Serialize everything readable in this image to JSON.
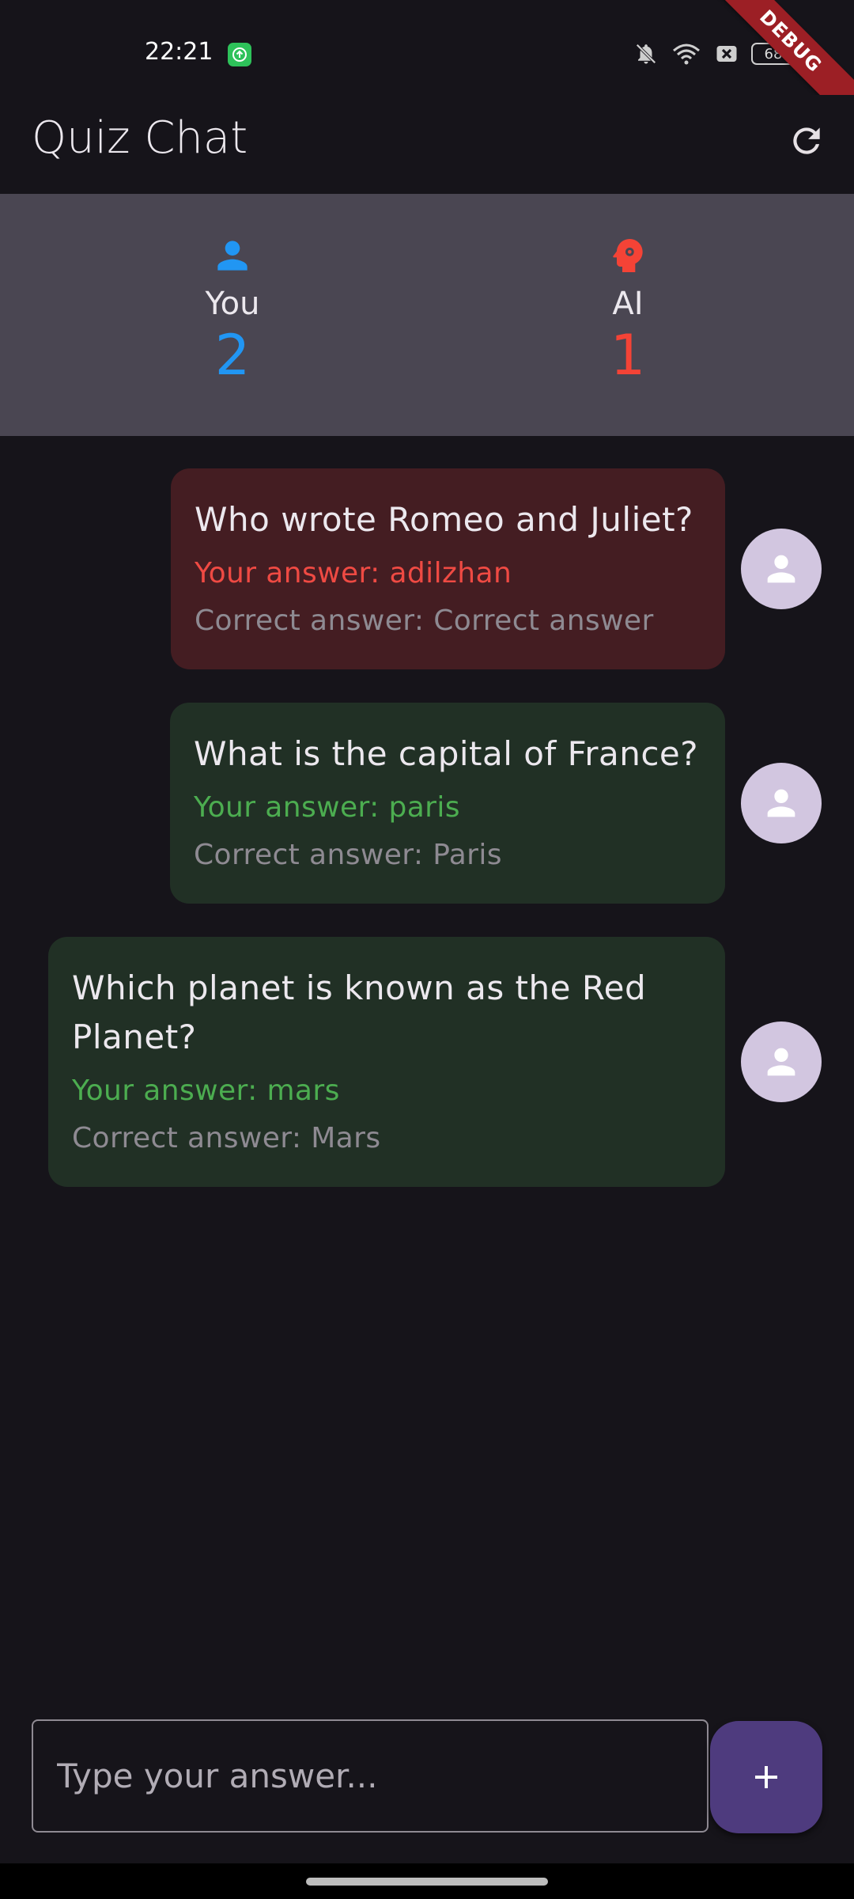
{
  "status_bar": {
    "time": "22:21",
    "battery": "68"
  },
  "debug_banner": "DEBUG",
  "app_bar": {
    "title": "Quiz Chat",
    "refresh_icon": "refresh-icon"
  },
  "scores": {
    "you": {
      "label": "You",
      "value": "2",
      "icon": "person-icon",
      "color": "#2196f3"
    },
    "ai": {
      "label": "AI",
      "value": "1",
      "icon": "psychology-icon",
      "color": "#f44336"
    }
  },
  "messages": [
    {
      "question": "Who wrote Romeo and Juliet?",
      "your_answer": "Your answer: adilzhan",
      "correct_answer": "Correct answer: Correct answer",
      "status": "wrong"
    },
    {
      "question": "What is the capital of France?",
      "your_answer": "Your answer: paris",
      "correct_answer": "Correct answer: Paris",
      "status": "correct"
    },
    {
      "question": "Which planet is known as the Red Planet?",
      "your_answer": "Your answer: mars",
      "correct_answer": "Correct answer: Mars",
      "status": "correct"
    }
  ],
  "input": {
    "placeholder": "Type your answer...",
    "value": ""
  },
  "fab": {
    "icon": "add-icon"
  },
  "colors": {
    "wrong_bubble": "#441d22",
    "correct_bubble": "#213025",
    "wrong_text": "#ef4a43",
    "correct_text": "#4cad50",
    "fab": "#4e3b7e"
  }
}
